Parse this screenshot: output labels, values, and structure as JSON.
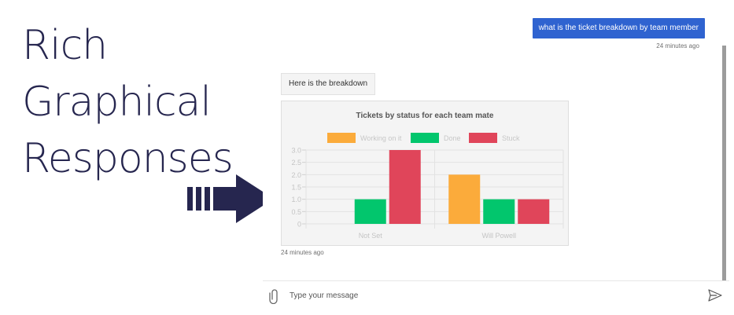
{
  "headline": {
    "lines": [
      "Rich",
      "Graphical",
      "Responses"
    ]
  },
  "colors": {
    "navy": "#26264f",
    "user_bubble": "#2f63d0",
    "orange": "#fbab3b",
    "green": "#02c66d",
    "red": "#e0455a"
  },
  "messages": {
    "user": {
      "text": "what is the ticket breakdown by team member",
      "timestamp": "24 minutes ago"
    },
    "bot": {
      "text": "Here is the breakdown",
      "timestamp": "24 minutes ago"
    }
  },
  "composer": {
    "placeholder": "Type your message",
    "attach_icon": "paperclip-icon",
    "send_icon": "send-icon"
  },
  "chart_data": {
    "type": "bar",
    "title": "Tickets by status for each team mate",
    "categories": [
      "Not Set",
      "Will Powell"
    ],
    "series": [
      {
        "name": "Working on it",
        "color": "#fbab3b",
        "values": [
          0,
          2
        ]
      },
      {
        "name": "Done",
        "color": "#02c66d",
        "values": [
          1,
          1
        ]
      },
      {
        "name": "Stuck",
        "color": "#e0455a",
        "values": [
          3,
          1
        ]
      }
    ],
    "yticks": [
      "3.0",
      "2.5",
      "2.0",
      "1.5",
      "1.0",
      "0.5",
      "0"
    ],
    "ylim": [
      0,
      3
    ],
    "legend_position": "top",
    "grid": true
  }
}
